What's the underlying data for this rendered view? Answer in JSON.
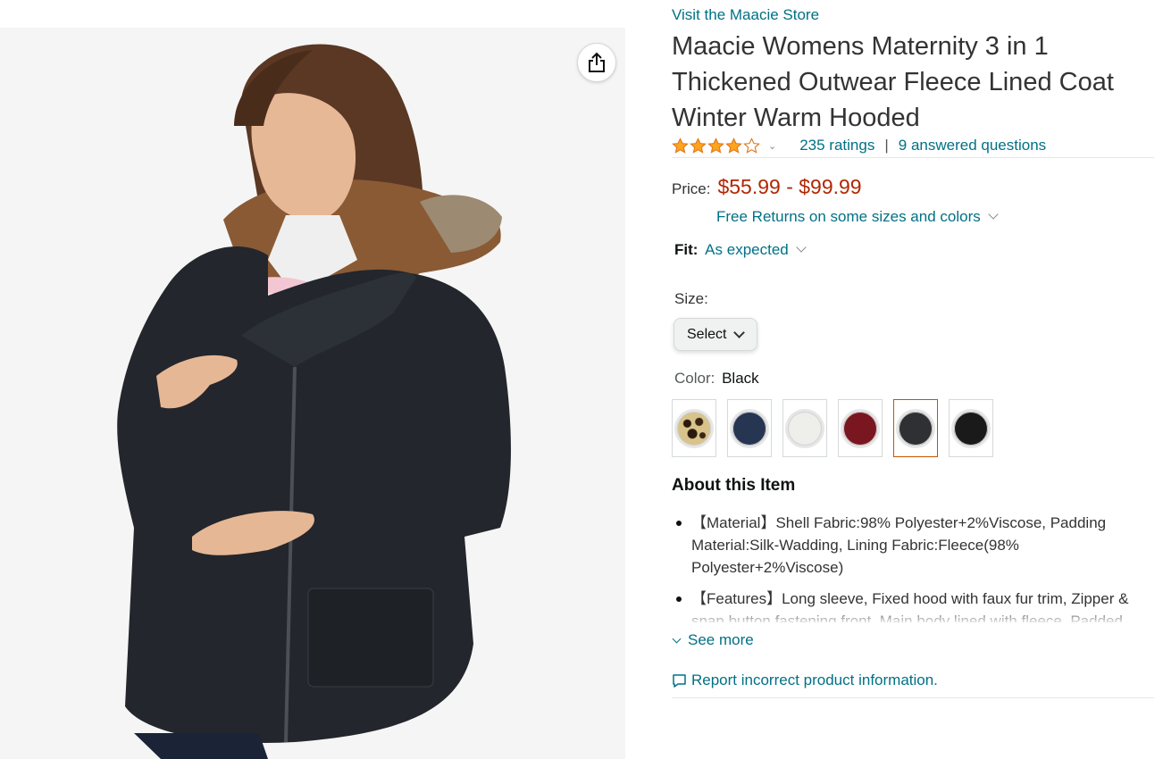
{
  "product_image": {
    "alt": "Maacie Womens Maternity 3 in 1 Thickened Outwear Fleece Lined Coat Winter Warm Hooded",
    "share_icon": "share-icon"
  },
  "store": {
    "link_label": "Visit the Maacie Store"
  },
  "product": {
    "title": "Maacie Womens Maternity 3 in 1 Thickened Outwear Fleece Lined Coat Winter Warm Hooded"
  },
  "rating": {
    "stars": 4.0,
    "max_stars": 5,
    "ratings_label": "235 ratings",
    "separator": "|",
    "questions_label": "9 answered questions",
    "star_color": "#ffa41c"
  },
  "price": {
    "label": "Price:",
    "value": "$55.99 - $99.99",
    "color": "#b12704"
  },
  "returns": {
    "label": "Free Returns on some sizes and colors"
  },
  "fit": {
    "label": "Fit:",
    "value": "As expected"
  },
  "size": {
    "label": "Size:",
    "selected": "Select"
  },
  "color": {
    "label": "Color:",
    "selected": "Black",
    "swatches": [
      {
        "name": "leopard",
        "color": "#d8c48a"
      },
      {
        "name": "navy",
        "color": "#263552"
      },
      {
        "name": "white",
        "color": "#eeeeea"
      },
      {
        "name": "wine-red",
        "color": "#7a1620"
      },
      {
        "name": "dark-grey",
        "color": "#2e3034"
      },
      {
        "name": "black",
        "color": "#1a1a1a"
      }
    ],
    "selected_index": 4
  },
  "about": {
    "heading": "About this Item",
    "bullets": [
      "【Material】Shell Fabric:98% Polyester+2%Viscose, Padding Material:Silk-Wadding, Lining Fabric:Fleece(98% Polyester+2%Viscose)",
      "【Features】Long sleeve, Fixed hood with faux fur trim, Zipper & snap button fastening front, Main body lined with fleece, Padded"
    ],
    "see_more_label": "See more"
  },
  "report": {
    "label": "Report incorrect product information."
  },
  "colors": {
    "link": "#007185",
    "accent_selected": "#c45500"
  }
}
